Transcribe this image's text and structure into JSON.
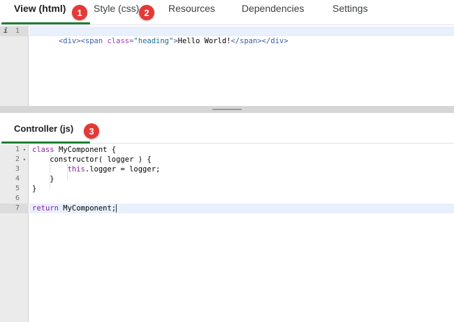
{
  "tabs": [
    {
      "label": "View (html)",
      "active": true
    },
    {
      "label": "Style (css)",
      "active": false
    },
    {
      "label": "Resources",
      "active": false
    },
    {
      "label": "Dependencies",
      "active": false
    },
    {
      "label": "Settings",
      "active": false
    }
  ],
  "badges": [
    "1",
    "2",
    "3"
  ],
  "view_editor": {
    "gutter_info": "i",
    "line_numbers": [
      "1"
    ],
    "lines": [
      [
        {
          "t": "<div><span ",
          "c": "tag"
        },
        {
          "t": "class=",
          "c": "attr"
        },
        {
          "t": "\"heading\"",
          "c": "str"
        },
        {
          "t": ">",
          "c": "tag"
        },
        {
          "t": "Hello World!",
          "c": "plain"
        },
        {
          "t": "</span></div>",
          "c": "tag"
        }
      ]
    ]
  },
  "controller": {
    "title": "Controller (js)",
    "line_numbers": [
      "1",
      "2",
      "3",
      "4",
      "5",
      "6",
      "7"
    ],
    "folds": [
      "▾",
      "▾",
      "",
      "",
      "",
      "",
      ""
    ],
    "lines": [
      [
        {
          "t": "class ",
          "c": "kw"
        },
        {
          "t": "MyComponent {",
          "c": "plain"
        }
      ],
      [
        {
          "t": "    constructor( logger ) {",
          "c": "plain"
        }
      ],
      [
        {
          "t": "        ",
          "c": "plain"
        },
        {
          "t": "this",
          "c": "kw"
        },
        {
          "t": ".logger = logger;",
          "c": "plain"
        }
      ],
      [
        {
          "t": "    }",
          "c": "plain"
        }
      ],
      [
        {
          "t": "}",
          "c": "plain"
        }
      ],
      [
        {
          "t": "",
          "c": "plain"
        }
      ],
      [
        {
          "t": "return ",
          "c": "kw"
        },
        {
          "t": "MyComponent;",
          "c": "plain"
        }
      ]
    ]
  },
  "colors": {
    "accent_green": "#1e7e34",
    "badge_red": "#e53935",
    "active_line": "#e8f0fc"
  }
}
